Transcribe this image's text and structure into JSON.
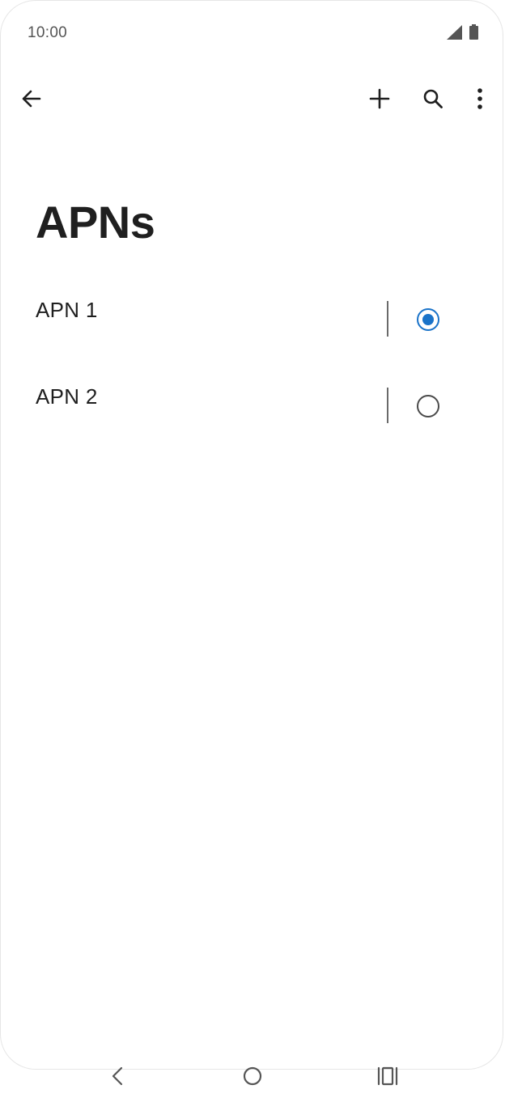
{
  "status_bar": {
    "time": "10:00",
    "icons": [
      "signal-icon",
      "battery-icon"
    ]
  },
  "toolbar": {
    "back_icon": "arrow-left-icon",
    "add_icon": "plus-icon",
    "search_icon": "search-icon",
    "more_icon": "more-vertical-icon"
  },
  "page": {
    "title": "APNs"
  },
  "apns": [
    {
      "name": "APN 1",
      "selected": true
    },
    {
      "name": "APN 2",
      "selected": false
    }
  ],
  "nav_bar": {
    "icons": [
      "nav-back-icon",
      "nav-home-icon",
      "nav-recents-icon"
    ]
  },
  "colors": {
    "accent": "#1a73c9",
    "text": "#1f1f1f",
    "status_text": "#555555"
  }
}
